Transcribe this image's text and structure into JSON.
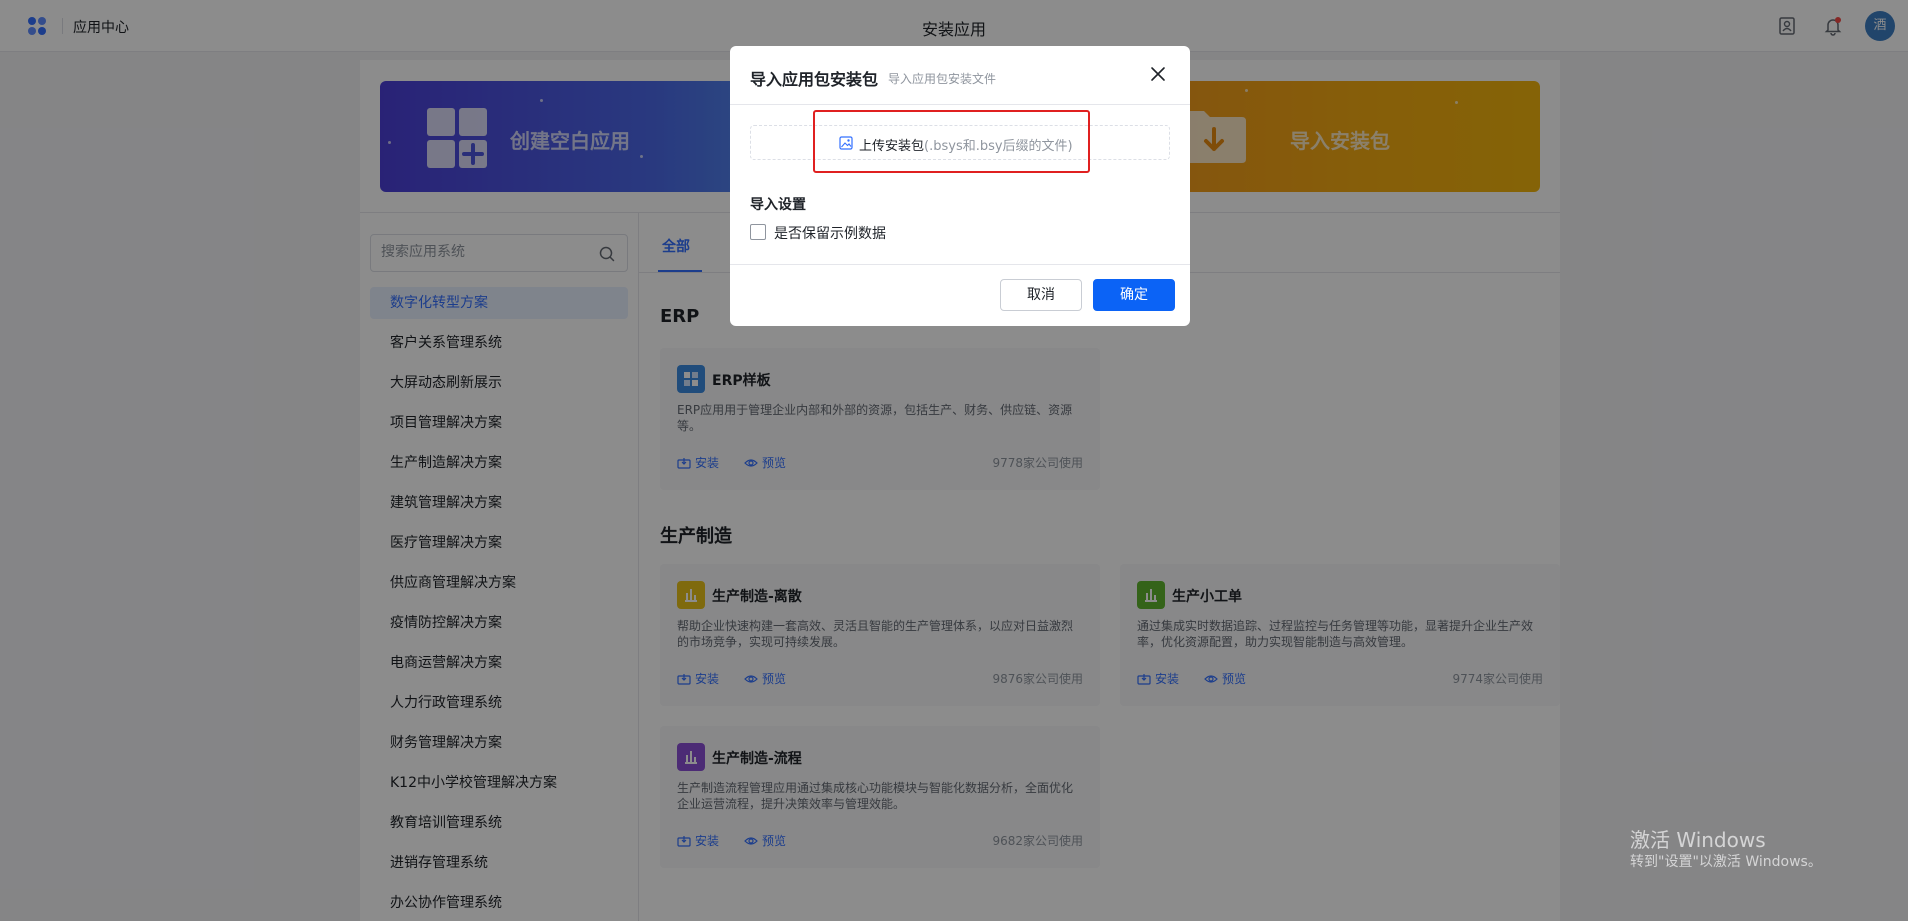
{
  "topbar": {
    "app_title": "应用中心",
    "page_title": "安装应用",
    "avatar_text": "酒"
  },
  "banners": {
    "blank_label": "创建空白应用",
    "import_label": "导入安装包"
  },
  "sidebar": {
    "search_placeholder": "搜索应用系统",
    "items": [
      "数字化转型方案",
      "客户关系管理系统",
      "大屏动态刷新展示",
      "项目管理解决方案",
      "生产制造解决方案",
      "建筑管理解决方案",
      "医疗管理解决方案",
      "供应商管理解决方案",
      "疫情防控解决方案",
      "电商运营解决方案",
      "人力行政管理系统",
      "财务管理解决方案",
      "K12中小学校管理解决方案",
      "教育培训管理系统",
      "进销存管理系统",
      "办公协作管理系统"
    ]
  },
  "tabs": {
    "all": "全部"
  },
  "sections": {
    "erp": "ERP",
    "manufacturing": "生产制造"
  },
  "actions": {
    "install": "安装",
    "preview": "预览"
  },
  "cards": [
    {
      "title": "ERP样板",
      "desc": "ERP应用用于管理企业内部和外部的资源，包括生产、财务、供应链、资源等。",
      "usage": "9778家公司使用",
      "icon": "erp-grid-icon",
      "color": "#3b8be0"
    },
    {
      "title": "生产制造-离散",
      "desc": "帮助企业快速构建一套高效、灵活且智能的生产管理体系，以应对日益激烈的市场竞争，实现可持续发展。",
      "usage": "9876家公司使用",
      "icon": "bar-chart-icon",
      "color": "#e8c21a"
    },
    {
      "title": "生产小工单",
      "desc": "通过集成实时数据追踪、过程监控与任务管理等功能，显著提升企业生产效率，优化资源配置，助力实现智能制造与高效管理。",
      "usage": "9774家公司使用",
      "icon": "bar-chart-icon",
      "color": "#5fb52e"
    },
    {
      "title": "生产制造-流程",
      "desc": "生产制造流程管理应用通过集成核心功能模块与智能化数据分析，全面优化企业运营流程，提升决策效率与管理效能。",
      "usage": "9682家公司使用",
      "icon": "bar-chart-icon",
      "color": "#8a4fd6"
    }
  ],
  "modal": {
    "title": "导入应用包安装包",
    "subtitle": "导入应用包安装文件",
    "upload_label": "上传安装包",
    "upload_hint": "(.bsys和.bsy后缀的文件)",
    "settings_title": "导入设置",
    "checkbox_label": "是否保留示例数据",
    "cancel": "取消",
    "ok": "确定"
  },
  "watermark": {
    "line1": "激活 Windows",
    "line2": "转到\"设置\"以激活 Windows。"
  },
  "colors": {
    "accent": "#3370ff",
    "primary_button": "#0b63f6",
    "highlight": "#e02020"
  }
}
